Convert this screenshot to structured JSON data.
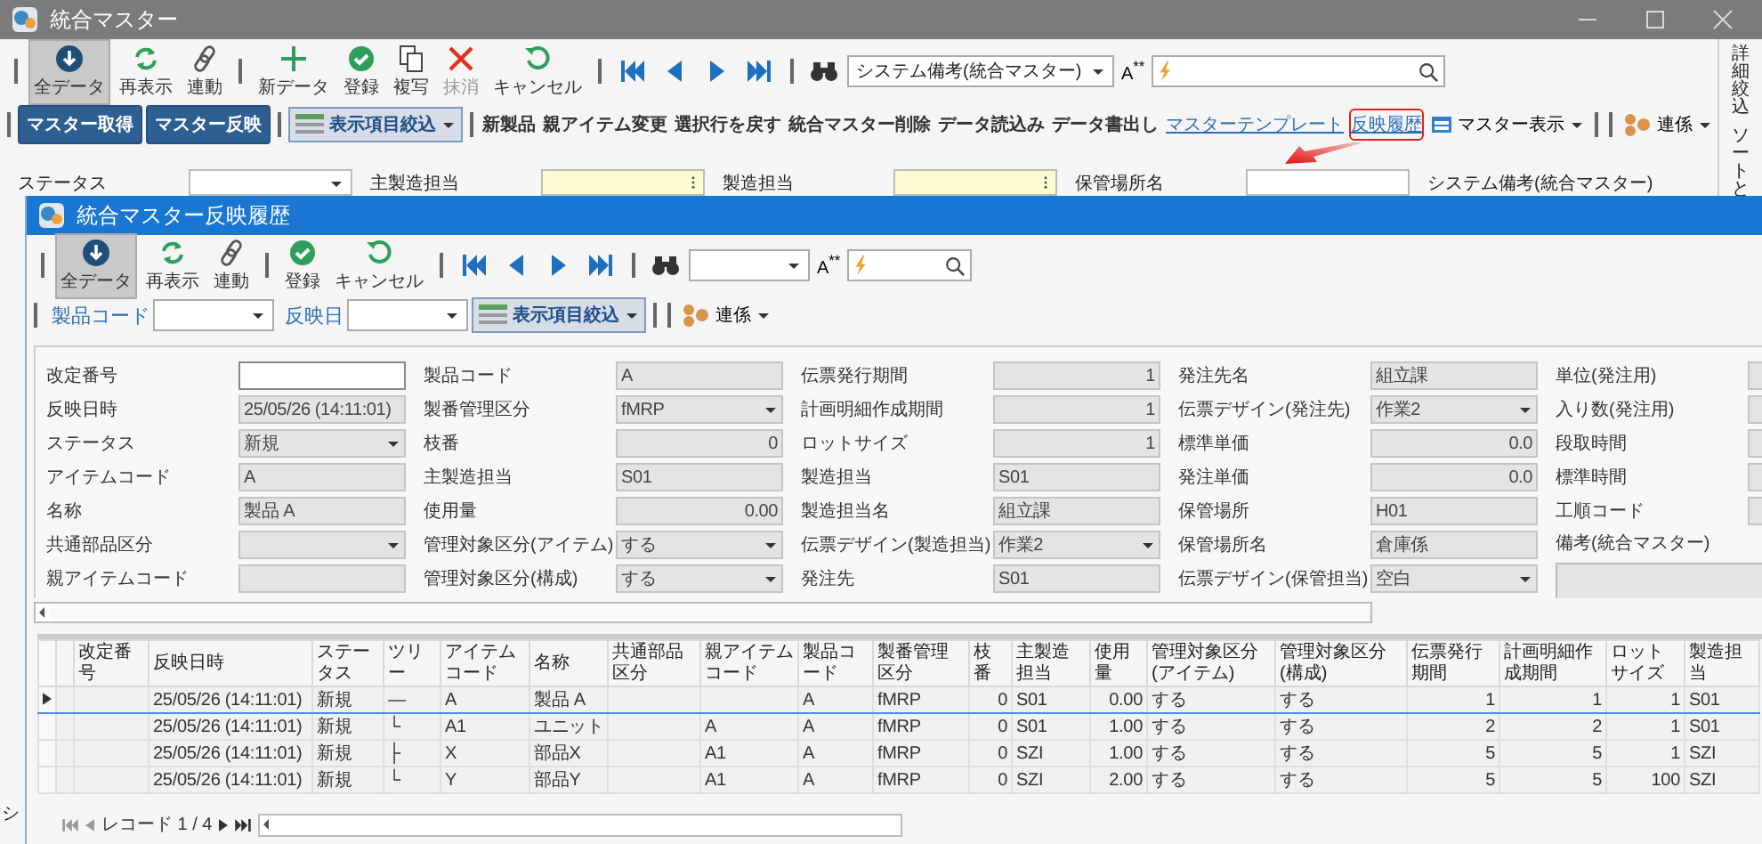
{
  "main_window": {
    "title": "統合マスター",
    "toolbar": {
      "action_groups": [
        [
          {
            "label": "全データ",
            "selected": true,
            "disabled": false
          },
          {
            "label": "再表示",
            "selected": false,
            "disabled": false
          },
          {
            "label": "連動",
            "selected": false,
            "disabled": false
          }
        ],
        [
          {
            "label": "新データ",
            "selected": false,
            "disabled": false
          },
          {
            "label": "登録",
            "selected": false,
            "disabled": false
          },
          {
            "label": "複写",
            "selected": false,
            "disabled": false
          },
          {
            "label": "抹消",
            "selected": false,
            "disabled": true
          },
          {
            "label": "キャンセル",
            "selected": false,
            "disabled": false
          }
        ]
      ],
      "search_scope": "システム備考(統合マスター)",
      "font_button": "A$^{**}$"
    },
    "commands": {
      "master_buttons": [
        "マスター取得",
        "マスター反映"
      ],
      "filter_menu": "表示項目絞込",
      "actions": [
        "新製品",
        "親アイテム変更",
        "選択行を戻す",
        "統合マスター削除",
        "データ読込み",
        "データ書出し"
      ],
      "links": [
        {
          "label": "マスターテンプレート",
          "highlighted": false
        },
        {
          "label": "反映履歴",
          "highlighted": true
        }
      ],
      "view_menu": "マスター表示",
      "link_menu": "連係"
    },
    "filters": [
      {
        "label": "ステータス",
        "kind": "select",
        "required": false
      },
      {
        "label": "主製造担当",
        "kind": "picker",
        "required": true
      },
      {
        "label": "製造担当",
        "kind": "picker",
        "required": true
      },
      {
        "label": "保管場所名",
        "kind": "text",
        "required": false
      },
      {
        "label": "システム備考(統合マスター)",
        "kind": "label"
      }
    ],
    "side_tabs": [
      "詳細絞込",
      "ソートと"
    ],
    "left_edge_text": "シ"
  },
  "dialog": {
    "title": "統合マスター反映履歴",
    "toolbar": {
      "action_groups": [
        [
          {
            "label": "全データ",
            "selected": true,
            "disabled": false
          },
          {
            "label": "再表示",
            "selected": false,
            "disabled": false
          },
          {
            "label": "連動",
            "selected": false,
            "disabled": false
          }
        ],
        [
          {
            "label": "登録",
            "selected": false,
            "disabled": false
          },
          {
            "label": "キャンセル",
            "selected": false,
            "disabled": false
          }
        ]
      ],
      "font_button": "A$^{**}$"
    },
    "filters": [
      {
        "label": "製品コード"
      },
      {
        "label": "反映日"
      }
    ],
    "filter_menu": "表示項目絞込",
    "link_menu": "連係",
    "form": {
      "columns": [
        [
          {
            "label": "改定番号",
            "kind": "text",
            "editable": true
          },
          {
            "label": "反映日時",
            "kind": "text",
            "editable": false,
            "value": "25/05/26 (14:11:01)"
          },
          {
            "label": "ステータス",
            "kind": "select",
            "editable": false,
            "value": "新規"
          },
          {
            "label": "アイテムコード",
            "kind": "text",
            "editable": false,
            "value": "A"
          },
          {
            "label": "名称",
            "kind": "text",
            "editable": false,
            "value": "製品 A"
          },
          {
            "label": "共通部品区分",
            "kind": "select",
            "editable": false
          },
          {
            "label": "親アイテムコード",
            "kind": "text",
            "editable": false
          }
        ],
        [
          {
            "label": "製品コード",
            "kind": "text",
            "editable": false,
            "value": "A"
          },
          {
            "label": "製番管理区分",
            "kind": "select",
            "editable": false,
            "value": "fMRP"
          },
          {
            "label": "枝番",
            "kind": "number",
            "editable": false,
            "value": "0"
          },
          {
            "label": "主製造担当",
            "kind": "text",
            "editable": false,
            "value": "S01"
          },
          {
            "label": "使用量",
            "kind": "number",
            "editable": false,
            "value": "0.00"
          },
          {
            "label": "管理対象区分(アイテム)",
            "kind": "select",
            "editable": false,
            "value": "する"
          },
          {
            "label": "管理対象区分(構成)",
            "kind": "select",
            "editable": false,
            "value": "する"
          }
        ],
        [
          {
            "label": "伝票発行期間",
            "kind": "number",
            "editable": false,
            "value": "1"
          },
          {
            "label": "計画明細作成期間",
            "kind": "number",
            "editable": false,
            "value": "1"
          },
          {
            "label": "ロットサイズ",
            "kind": "number",
            "editable": false,
            "value": "1"
          },
          {
            "label": "製造担当",
            "kind": "text",
            "editable": false,
            "value": "S01"
          },
          {
            "label": "製造担当名",
            "kind": "text",
            "editable": false,
            "value": "組立課"
          },
          {
            "label": "伝票デザイン(製造担当)",
            "kind": "select",
            "editable": false,
            "value": "作業2"
          },
          {
            "label": "発注先",
            "kind": "text",
            "editable": false,
            "value": "S01"
          }
        ],
        [
          {
            "label": "発注先名",
            "kind": "text",
            "editable": false,
            "value": "組立課"
          },
          {
            "label": "伝票デザイン(発注先)",
            "kind": "select",
            "editable": false,
            "value": "作業2"
          },
          {
            "label": "標準単価",
            "kind": "number",
            "editable": false,
            "value": "0.0"
          },
          {
            "label": "発注単価",
            "kind": "number",
            "editable": false,
            "value": "0.0"
          },
          {
            "label": "保管場所",
            "kind": "text",
            "editable": false,
            "value": "H01"
          },
          {
            "label": "保管場所名",
            "kind": "text",
            "editable": false,
            "value": "倉庫係"
          },
          {
            "label": "伝票デザイン(保管担当)",
            "kind": "select",
            "editable": false,
            "value": "空白"
          }
        ],
        [
          {
            "label": "単位(発注用)",
            "kind": "text",
            "editable": false
          },
          {
            "label": "入り数(発注用)",
            "kind": "text",
            "editable": false
          },
          {
            "label": "段取時間",
            "kind": "text",
            "editable": false
          },
          {
            "label": "標準時間",
            "kind": "text",
            "editable": false
          },
          {
            "label": "工順コード",
            "kind": "text",
            "editable": false
          },
          {
            "label": "備考(統合マスター)",
            "kind": "memo",
            "editable": false
          }
        ]
      ]
    },
    "grid": {
      "columns": [
        "改定番号",
        "反映日時",
        "ステータス",
        "ツリー",
        "アイテムコード",
        "名称",
        "共通部品区分",
        "親アイテムコード",
        "製品コード",
        "製番管理区分",
        "枝番",
        "主製造担当",
        "使用量",
        "管理対象区分(アイテム)",
        "管理対象区分(構成)",
        "伝票発行期間",
        "計画明細作成期間",
        "ロットサイズ",
        "製造担当"
      ],
      "rows": [
        {
          "current": true,
          "cells": [
            null,
            "25/05/26 (14:11:01)",
            "新規",
            "—",
            "A",
            "製品 A",
            null,
            null,
            "A",
            "fMRP",
            "0",
            "S01",
            "0.00",
            "する",
            "する",
            "1",
            "1",
            "1",
            "S01"
          ]
        },
        {
          "current": false,
          "cells": [
            null,
            "25/05/26 (14:11:01)",
            "新規",
            "└",
            "A1",
            "ユニット",
            null,
            "A",
            "A",
            "fMRP",
            "0",
            "S01",
            "1.00",
            "する",
            "する",
            "2",
            "2",
            "1",
            "S01"
          ]
        },
        {
          "current": false,
          "cells": [
            null,
            "25/05/26 (14:11:01)",
            "新規",
            "├",
            "X",
            "部品X",
            null,
            "A1",
            "A",
            "fMRP",
            "0",
            "SZI",
            "1.00",
            "する",
            "する",
            "5",
            "5",
            "1",
            "SZI"
          ]
        },
        {
          "current": false,
          "cells": [
            null,
            "25/05/26 (14:11:01)",
            "新規",
            "└",
            "Y",
            "部品Y",
            null,
            "A1",
            "A",
            "fMRP",
            "0",
            "SZI",
            "2.00",
            "する",
            "する",
            "5",
            "5",
            "100",
            "SZI"
          ]
        }
      ],
      "record_label": "レコード 1 / 4"
    }
  }
}
